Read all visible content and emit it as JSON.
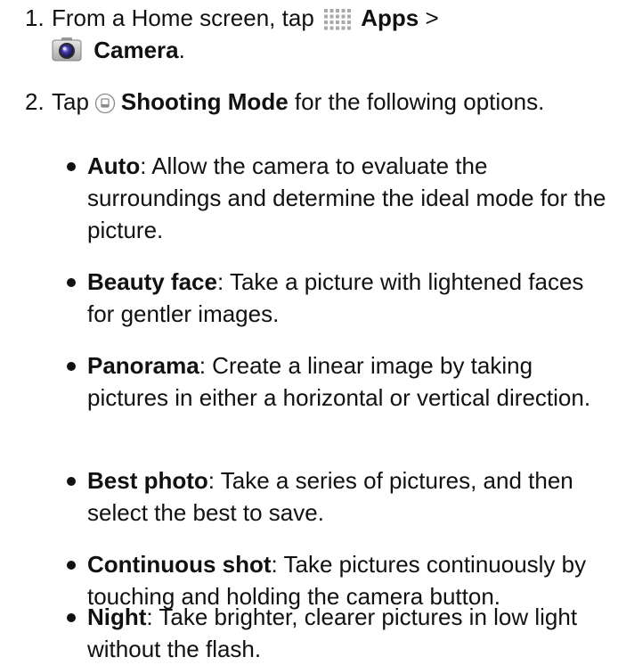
{
  "steps": [
    {
      "number": "1.",
      "prefix": "From a Home screen, tap",
      "apps_label": "Apps",
      "separator": ">",
      "camera_label": "Camera",
      "suffix": ".",
      "icons": [
        "apps-grid-icon",
        "camera-icon"
      ]
    },
    {
      "number": "2.",
      "prefix": "Tap",
      "mode_label": "Shooting Mode",
      "suffix": "for the following options.",
      "icons": [
        "shooting-mode-icon"
      ]
    }
  ],
  "options": [
    {
      "name": "Auto",
      "desc": ": Allow the camera to evaluate the surroundings and determine the ideal mode for the picture."
    },
    {
      "name": "Beauty face",
      "desc": ": Take a picture with lightened faces for gentler images."
    },
    {
      "name": "Panorama",
      "desc": ": Create a linear image by taking pictures in either a horizontal or vertical direction."
    },
    {
      "name": "Best photo",
      "desc": ": Take a series of pictures, and then select the best to save."
    },
    {
      "name": "Continuous shot",
      "desc": ": Take pictures continuously by touching and holding the camera button."
    },
    {
      "name": "Night",
      "desc": ": Take brighter, clearer pictures in low light without the flash."
    }
  ]
}
